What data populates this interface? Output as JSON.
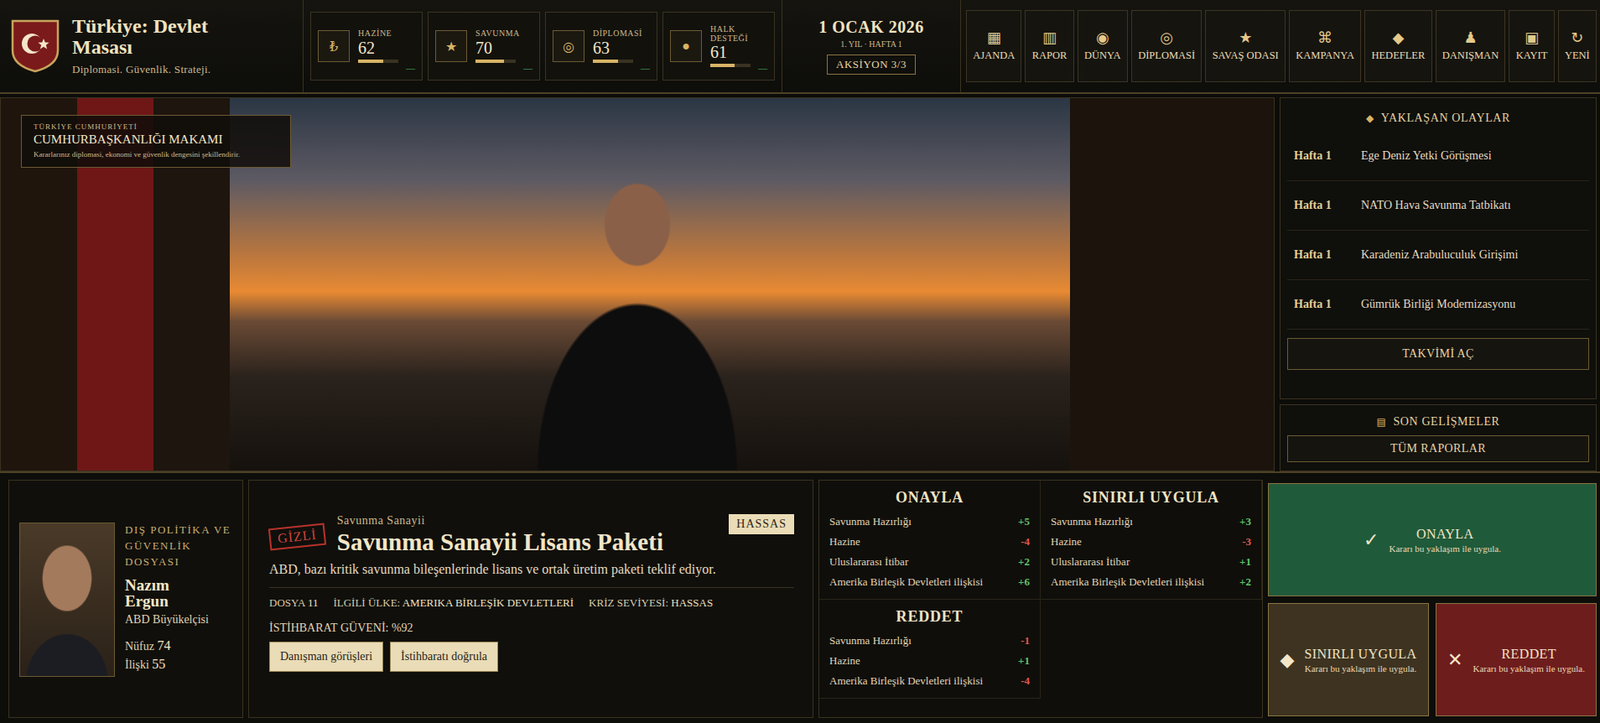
{
  "header": {
    "title": "Türkiye: Devlet Masası",
    "subtitle": "Diplomasi. Güvenlik. Strateji."
  },
  "stats": [
    {
      "label": "HAZİNE",
      "value": "62",
      "icon": "₺",
      "level": 0.62,
      "trend": "—"
    },
    {
      "label": "SAVUNMA",
      "value": "70",
      "icon": "★",
      "level": 0.7,
      "trend": "—"
    },
    {
      "label": "DİPLOMASİ",
      "value": "63",
      "icon": "◎",
      "level": 0.63,
      "trend": "—"
    },
    {
      "label": "HALK DESTEĞİ",
      "value": "61",
      "icon": "●",
      "level": 0.61,
      "trend": "—"
    }
  ],
  "date": {
    "date": "1 OCAK 2026",
    "week": "1. YIL · HAFTA 1",
    "actions": "AKSİYON 3/3"
  },
  "nav": [
    {
      "label": "AJANDA",
      "icon": "▦"
    },
    {
      "label": "RAPOR",
      "icon": "▥"
    },
    {
      "label": "DÜNYA",
      "icon": "◉"
    },
    {
      "label": "DİPLOMASİ",
      "icon": "◎"
    },
    {
      "label": "SAVAŞ ODASI",
      "icon": "★"
    },
    {
      "label": "KAMPANYA",
      "icon": "⌘"
    },
    {
      "label": "HEDEFLER",
      "icon": "◆"
    },
    {
      "label": "DANIŞMAN",
      "icon": "♟"
    },
    {
      "label": "KAYIT",
      "icon": "▣"
    },
    {
      "label": "YENİ",
      "icon": "↻"
    }
  ],
  "scene": {
    "kicker": "TÜRKİYE CUMHURİYETİ",
    "title": "CUMHURBAŞKANLIĞI MAKAMI",
    "text": "Kararlarınız diplomasi, ekonomi ve güvenlik dengesini şekillendirir."
  },
  "events": {
    "icon": "◆",
    "title": "YAKLAŞAN OLAYLAR",
    "button": "TAKVİMİ AÇ",
    "items": [
      {
        "week": "Hafta 1",
        "name": "Ege Deniz Yetki Görüşmesi"
      },
      {
        "week": "Hafta 1",
        "name": "NATO Hava Savunma Tatbikatı"
      },
      {
        "week": "Hafta 1",
        "name": "Karadeniz Arabuluculuk Girişimi"
      },
      {
        "week": "Hafta 1",
        "name": "Gümrük Birliği Modernizasyonu"
      }
    ]
  },
  "developments": {
    "icon": "▤",
    "title": "SON GELİŞMELER",
    "button": "TÜM RAPORLAR"
  },
  "advisor": {
    "section": "DIŞ POLİTİKA VE GÜVENLİK DOSYASI",
    "name": "Nazım Ergun",
    "role": "ABD Büyükelçisi",
    "stats": [
      {
        "label": "Nüfuz",
        "value": "74"
      },
      {
        "label": "İlişki",
        "value": "55"
      }
    ]
  },
  "file": {
    "stamp": "GİZLİ",
    "category": "Savunma Sanayii",
    "title": "Savunma Sanayii Lisans Paketi",
    "tag": "HASSAS",
    "description": "ABD, bazı kritik savunma bileşenlerinde lisans ve ortak üretim paketi teklif ediyor.",
    "meta": [
      {
        "label": "DOSYA",
        "value": "11"
      },
      {
        "label": "İLGİLİ ÜLKE:",
        "value": "AMERIKA BİRLEŞİK DEVLETLERİ"
      },
      {
        "label": "KRİZ SEVİYESİ:",
        "value": "HASSAS"
      }
    ],
    "intel": "İSTİHBARAT GÜVENİ: %92",
    "buttons": [
      "Danışman görüşleri",
      "İstihbaratı doğrula"
    ]
  },
  "options": [
    {
      "title": "ONAYLA",
      "effects": [
        {
          "label": "Savunma Hazırlığı",
          "value": "+5",
          "positive": true
        },
        {
          "label": "Hazine",
          "value": "-4",
          "positive": false
        },
        {
          "label": "Uluslararası İtibar",
          "value": "+2",
          "positive": true
        },
        {
          "label": "Amerika Birleşik Devletleri ilişkisi",
          "value": "+6",
          "positive": true
        }
      ]
    },
    {
      "title": "SINIRLI UYGULA",
      "effects": [
        {
          "label": "Savunma Hazırlığı",
          "value": "+3",
          "positive": true
        },
        {
          "label": "Hazine",
          "value": "-3",
          "positive": false
        },
        {
          "label": "Uluslararası İtibar",
          "value": "+1",
          "positive": true
        },
        {
          "label": "Amerika Birleşik Devletleri ilişkisi",
          "value": "+2",
          "positive": true
        }
      ]
    },
    {
      "title": "REDDET",
      "effects": [
        {
          "label": "Savunma Hazırlığı",
          "value": "-1",
          "positive": false
        },
        {
          "label": "Hazine",
          "value": "+1",
          "positive": true
        },
        {
          "label": "Amerika Birleşik Devletleri ilişkisi",
          "value": "-4",
          "positive": false
        }
      ]
    }
  ],
  "actions": [
    {
      "label": "ONAYLA",
      "sub": "Kararı bu yaklaşım ile uygula.",
      "icon": "✓",
      "color": "#1f5a3a"
    },
    {
      "label": "SINIRLI UYGULA",
      "sub": "Kararı bu yaklaşım ile uygula.",
      "icon": "◆",
      "color": "#3d3320"
    },
    {
      "label": "REDDET",
      "sub": "Kararı bu yaklaşım ile uygula.",
      "icon": "✕",
      "color": "#6e1d1d"
    }
  ]
}
